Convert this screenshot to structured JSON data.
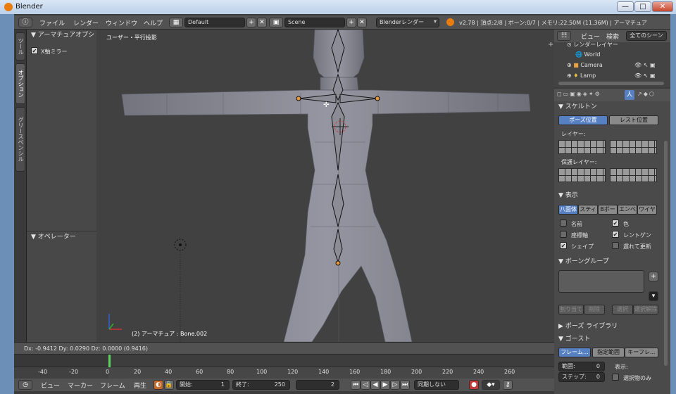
{
  "window": {
    "title": "Blender",
    "controls": [
      "—",
      "□",
      "✕"
    ]
  },
  "header": {
    "menus": [
      "ファイル",
      "レンダー",
      "ウィンドウ",
      "ヘルプ"
    ],
    "layout": "Default",
    "scene": "Scene",
    "renderer": "Blenderレンダー",
    "status": "v2.78 | 頂点:2/8 | ボーン:0/7 | メモリ:22.50M (11.36M) | アーマチュア"
  },
  "left_tabs": [
    "ツール",
    "オプション",
    "グリースペンシル"
  ],
  "shelf": {
    "armature_panel": "アーマチュアオプシ",
    "x_mirror": "X軸ミラー",
    "operator_panel": "オペレーター"
  },
  "viewport": {
    "view_name": "ユーザー・平行投影",
    "object_info": "(2) アーマチュア : Bone.002"
  },
  "vp_header": {
    "delta": "Dx: -0.9412  Dy: 0.0290  Dz: 0.0000 (0.9416)"
  },
  "timeline": {
    "ticks": [
      "-40",
      "-20",
      "0",
      "20",
      "40",
      "60",
      "80",
      "100",
      "120",
      "140",
      "160",
      "180",
      "200",
      "220",
      "240",
      "260"
    ]
  },
  "footer": {
    "menus": [
      "ビュー",
      "マーカー",
      "フレーム",
      "再生"
    ],
    "start": "開始:",
    "start_val": "1",
    "end": "終了:",
    "end_val": "250",
    "frame": "2",
    "sync": "同期しない"
  },
  "outliner": {
    "view": "ビュー",
    "search": "検索",
    "all_scenes": "全てのシーン",
    "items": [
      "レンダーレイヤー",
      "World",
      "Camera",
      "Lamp"
    ]
  },
  "props": {
    "skeleton": "スケルトン",
    "pose_position": "ポーズ位置",
    "rest_position": "レスト位置",
    "layers": "レイヤー:",
    "protected_layers": "保護レイヤー:",
    "display": "表示",
    "display_types": [
      "八面体",
      "スティ",
      "Bボー",
      "エンベ",
      "ワイヤ"
    ],
    "opt_names": "名前",
    "opt_colors": "色",
    "opt_axes": "座標軸",
    "opt_xray": "レントゲン",
    "opt_shapes": "シェイプ",
    "opt_delay": "遅れて更新",
    "bone_groups": "ボーングループ",
    "assign": "割り当て",
    "remove": "削除",
    "select": "選択",
    "deselect": "選択解除",
    "pose_library": "ポーズ ライブラリ",
    "ghost": "ゴースト",
    "ghost_types": [
      "フレーム...",
      "指定範囲",
      "キーフレ..."
    ],
    "range": "範囲:",
    "range_val": "0",
    "step": "ステップ:",
    "step_val": "0",
    "display_label": "表示:",
    "selected_only": "選択物のみ"
  },
  "colors": {
    "accent_blue": "#5680c2",
    "bone_outline": "#111111",
    "mesh": "#8c8c98"
  }
}
